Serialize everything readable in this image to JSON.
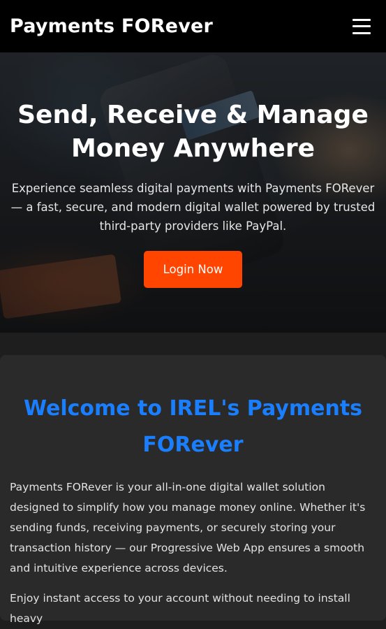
{
  "header": {
    "brand": "Payments FORever",
    "menu_icon": "hamburger-menu-icon"
  },
  "hero": {
    "title": "Send, Receive & Manage Money Anywhere",
    "subtitle": "Experience seamless digital payments with Payments FORever — a fast, secure, and modern digital wallet powered by trusted third-party providers like PayPal.",
    "cta_label": "Login Now",
    "cta_color": "#ff4500"
  },
  "welcome": {
    "title": "Welcome to IREL's Payments FORever",
    "title_color": "#1a7fff",
    "paragraphs": [
      "Payments FORever is your all-in-one digital wallet solution designed to simplify how you manage money online. Whether it's sending funds, receiving payments, or securely storing your transaction history — our Progressive Web App ensures a smooth and intuitive experience across devices.",
      "Enjoy instant access to your account without needing to install heavy"
    ]
  }
}
